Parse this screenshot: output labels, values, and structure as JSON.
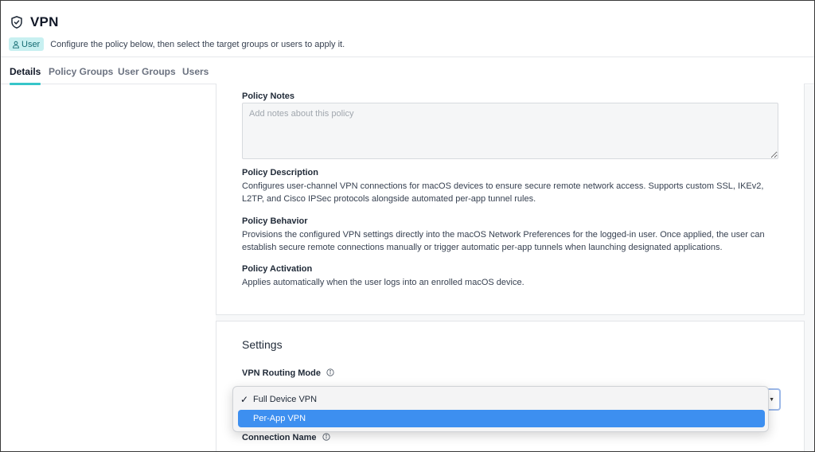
{
  "header": {
    "title": "VPN",
    "badge_label": "User",
    "subtitle": "Configure the policy below, then select the target groups or users to apply it.",
    "icon": "shield-check-icon"
  },
  "tabs": [
    {
      "label": "Details",
      "active": true
    },
    {
      "label": "Policy Groups",
      "active": false
    },
    {
      "label": "User Groups",
      "active": false
    },
    {
      "label": "Users",
      "active": false
    }
  ],
  "policy": {
    "notes_label": "Policy Notes",
    "notes_placeholder": "Add notes about this policy",
    "notes_value": "",
    "description_label": "Policy Description",
    "description_text": "Configures user-channel VPN connections for macOS devices to ensure secure remote network access. Supports custom SSL, IKEv2, L2TP, and Cisco IPSec protocols alongside automated per-app tunnel rules.",
    "behavior_label": "Policy Behavior",
    "behavior_text": "Provisions the configured VPN settings directly into the macOS Network Preferences for the logged-in user. Once applied, the user can establish secure remote connections manually or trigger automatic per-app tunnels when launching designated applications.",
    "activation_label": "Policy Activation",
    "activation_text": "Applies automatically when the user logs into an enrolled macOS device."
  },
  "settings": {
    "title": "Settings",
    "routing_mode_label": "VPN Routing Mode",
    "routing_mode_value": "Full Device VPN",
    "routing_mode_options": [
      {
        "label": "Full Device VPN",
        "selected": true,
        "highlighted": false
      },
      {
        "label": "Per-App VPN",
        "selected": false,
        "highlighted": true
      }
    ],
    "connection_name_label": "Connection Name"
  },
  "colors": {
    "accent": "#36c5c9",
    "badge_bg": "#c8f0f1",
    "badge_text": "#146b72",
    "highlight": "#3d8ff0"
  }
}
